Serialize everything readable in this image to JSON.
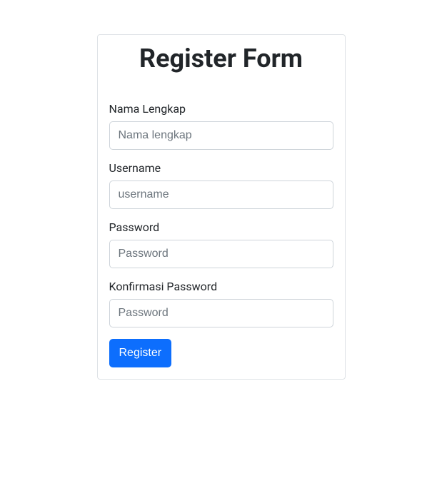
{
  "form": {
    "title": "Register Form",
    "fields": {
      "nama": {
        "label": "Nama Lengkap",
        "placeholder": "Nama lengkap",
        "value": ""
      },
      "username": {
        "label": "Username",
        "placeholder": "username",
        "value": ""
      },
      "password": {
        "label": "Password",
        "placeholder": "Password",
        "value": ""
      },
      "confirm": {
        "label": "Konfirmasi Password",
        "placeholder": "Password",
        "value": ""
      }
    },
    "submit_label": "Register"
  }
}
